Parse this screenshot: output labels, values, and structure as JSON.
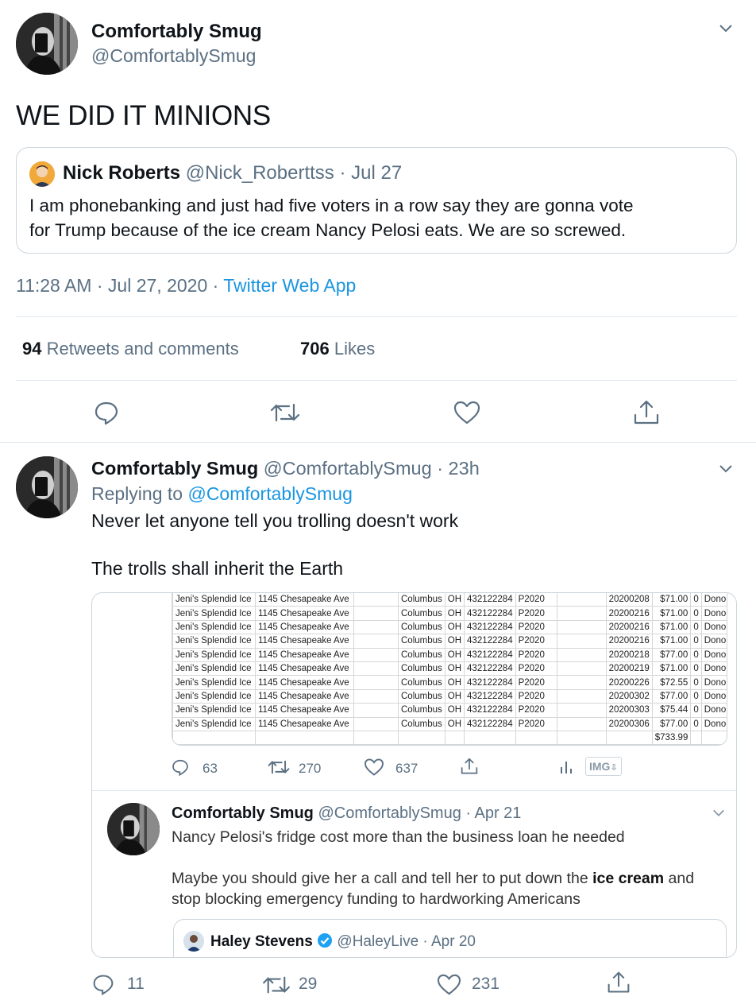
{
  "main_tweet": {
    "display_name": "Comfortably Smug",
    "handle": "@ComfortablySmug",
    "text": "WE DID IT MINIONS",
    "quoted": {
      "display_name": "Nick Roberts",
      "handle": "@Nick_Roberttss",
      "date": "· Jul 27",
      "text_line1": "I am phonebanking and just had five voters in a row say they are gonna vote",
      "text_line2": "for Trump because of the ice cream Nancy Pelosi eats. We are so screwed."
    },
    "timestamp": "11:28 AM · Jul 27, 2020 ·",
    "source": "Twitter Web App",
    "retweets_count": "94",
    "retweets_label": "Retweets and comments",
    "likes_count": "706",
    "likes_label": "Likes"
  },
  "reply": {
    "display_name": "Comfortably Smug",
    "handle_time": "@ComfortablySmug · 23h",
    "replying_prefix": "Replying to",
    "replying_to": "@ComfortablySmug",
    "text_line1": "Never let anyone tell you trolling doesn't work",
    "text_line2": "The trolls shall inherit the Earth",
    "stats": {
      "replies": "11",
      "retweets": "29",
      "likes": "231"
    }
  },
  "screenshot": {
    "rows": [
      [
        "Jeni's Splendid Ice",
        "1145 Chesapeake Ave",
        "Columbus",
        "OH",
        "432122284",
        "P2020",
        "20200208",
        "$71.00",
        "0",
        "Donor Gifts"
      ],
      [
        "Jeni's Splendid Ice",
        "1145 Chesapeake Ave",
        "Columbus",
        "OH",
        "432122284",
        "P2020",
        "20200216",
        "$71.00",
        "0",
        "Donor Gifts"
      ],
      [
        "Jeni's Splendid Ice",
        "1145 Chesapeake Ave",
        "Columbus",
        "OH",
        "432122284",
        "P2020",
        "20200216",
        "$71.00",
        "0",
        "Donor Gifts"
      ],
      [
        "Jeni's Splendid Ice",
        "1145 Chesapeake Ave",
        "Columbus",
        "OH",
        "432122284",
        "P2020",
        "20200216",
        "$71.00",
        "0",
        "Donor Gifts"
      ],
      [
        "Jeni's Splendid Ice",
        "1145 Chesapeake Ave",
        "Columbus",
        "OH",
        "432122284",
        "P2020",
        "20200218",
        "$77.00",
        "0",
        "Donor Gifts"
      ],
      [
        "Jeni's Splendid Ice",
        "1145 Chesapeake Ave",
        "Columbus",
        "OH",
        "432122284",
        "P2020",
        "20200219",
        "$71.00",
        "0",
        "Donor Gifts"
      ],
      [
        "Jeni's Splendid Ice",
        "1145 Chesapeake Ave",
        "Columbus",
        "OH",
        "432122284",
        "P2020",
        "20200226",
        "$72.55",
        "0",
        "Donor Gifts"
      ],
      [
        "Jeni's Splendid Ice",
        "1145 Chesapeake Ave",
        "Columbus",
        "OH",
        "432122284",
        "P2020",
        "20200302",
        "$77.00",
        "0",
        "Donor Gifts"
      ],
      [
        "Jeni's Splendid Ice",
        "1145 Chesapeake Ave",
        "Columbus",
        "OH",
        "432122284",
        "P2020",
        "20200303",
        "$75.44",
        "0",
        "Donor Gifts"
      ],
      [
        "Jeni's Splendid Ice",
        "1145 Chesapeake Ave",
        "Columbus",
        "OH",
        "432122284",
        "P2020",
        "20200306",
        "$77.00",
        "0",
        "Donor Gifts"
      ]
    ],
    "total": "$733.99",
    "stats": {
      "replies": "63",
      "retweets": "270",
      "likes": "637",
      "img_label": "IMG"
    },
    "nested_tweet": {
      "display_name": "Comfortably Smug",
      "handle_date": "@ComfortablySmug · Apr 21",
      "text_line1": "Nancy Pelosi's fridge cost more than the business loan he needed",
      "text_line2_before": "Maybe you should give her a call and tell her to put down the ",
      "text_line2_bold": "ice cream",
      "text_line2_after": " and",
      "text_line3": "stop blocking emergency funding to hardworking Americans",
      "quoted_name": "Haley Stevens",
      "quoted_handle_date": "@HaleyLive · Apr 20"
    }
  }
}
